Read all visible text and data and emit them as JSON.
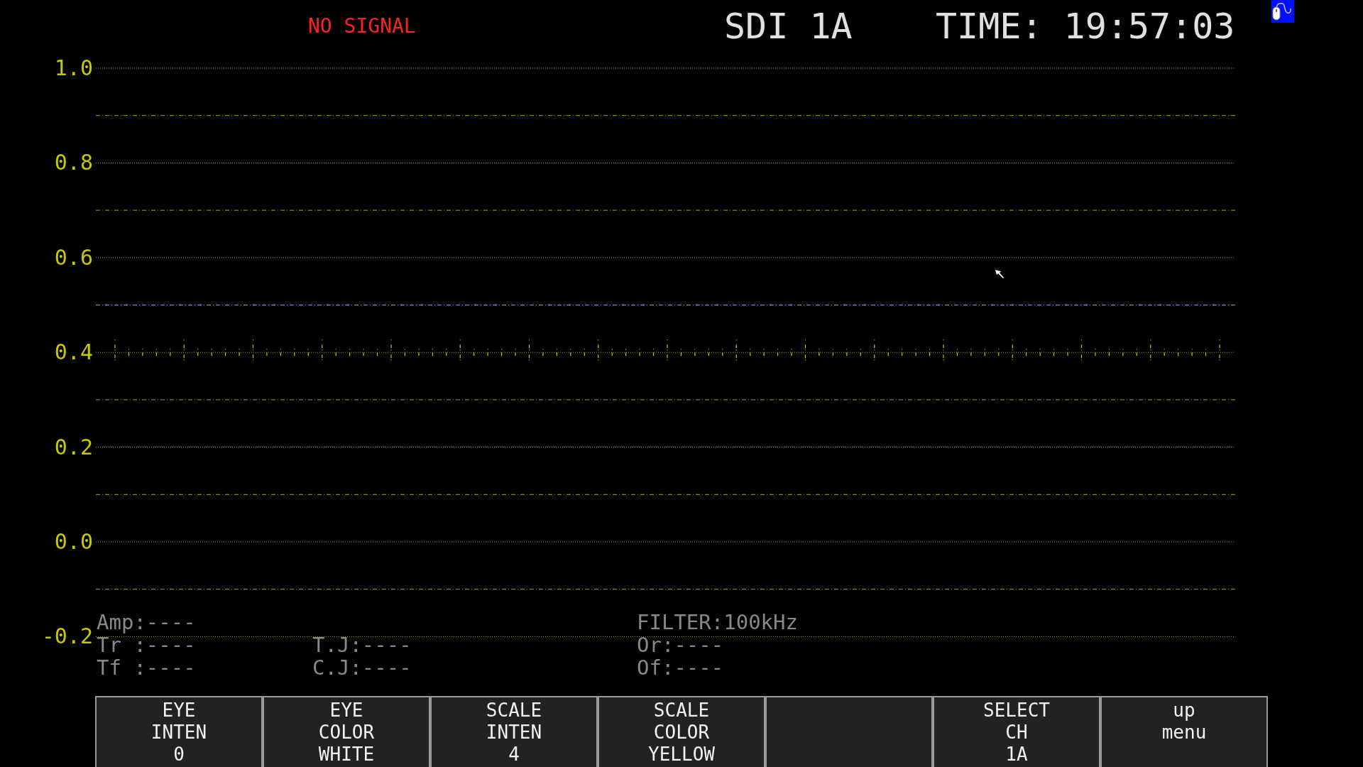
{
  "header": {
    "status": "NO SIGNAL",
    "input": "SDI 1A",
    "time": "TIME: 19:57:03"
  },
  "scale_labels": [
    "1.0",
    "0.8",
    "0.6",
    "0.4",
    "0.2",
    "0.0",
    "-0.2"
  ],
  "measurements": [
    {
      "column_1": "Amp:----",
      "column_3": "FILTER:100kHz"
    },
    {
      "column_1": "Tr :----",
      "column_2": "T.J:----",
      "column_3": "Or:----"
    },
    {
      "column_1": "Tf :----",
      "column_2": "C.J:----",
      "column_3": "Of:----"
    }
  ],
  "menu": [
    {
      "kind": "label",
      "lines": [
        "EYE",
        "INTEN",
        "0"
      ]
    },
    {
      "kind": "label",
      "lines": [
        "EYE",
        "COLOR",
        "WHITE"
      ]
    },
    {
      "kind": "label",
      "lines": [
        "SCALE",
        "INTEN",
        "4"
      ]
    },
    {
      "kind": "label",
      "lines": [
        "SCALE",
        "COLOR",
        "YELLOW"
      ]
    },
    {
      "kind": "blank"
    },
    {
      "kind": "label",
      "lines": [
        "SELECT",
        "CH",
        "1A"
      ]
    },
    {
      "kind": "label",
      "lines": [
        "up",
        "menu"
      ]
    }
  ]
}
